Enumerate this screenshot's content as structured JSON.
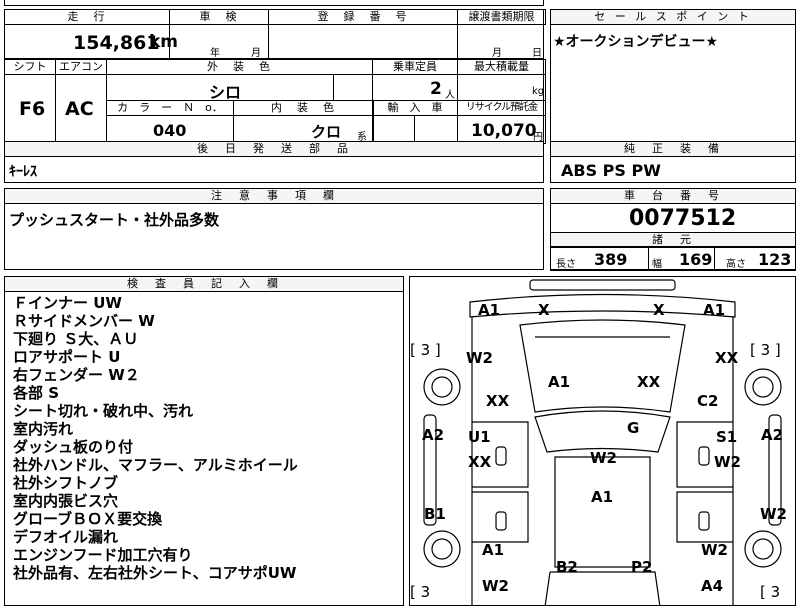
{
  "top": {
    "mileage_label": "走　行",
    "mileage_value": "154,861",
    "mileage_unit": "km",
    "inspection_label": "車　検",
    "year_unit": "年",
    "month_unit": "月",
    "reg_label": "登　録　番　号",
    "transfer_label": "譲渡書類期限",
    "t_month": "月",
    "t_day": "日"
  },
  "sales_point": {
    "label": "セ ー ル ス ポ イ ン ト",
    "text": "★オークションデビュー★"
  },
  "spec": {
    "shift_label": "シフト",
    "aircon_label": "エアコン",
    "exterior_label": "外　装　色",
    "capacity_label": "乗車定員",
    "maxload_label": "最大積載量",
    "shift_value": "F6",
    "aircon_value": "AC",
    "exterior_value": "シロ",
    "capacity_value": "2",
    "capacity_unit": "人",
    "maxload_unit": "kg",
    "color_no_label": "カ　ラ　ー　Ｎ　o．",
    "interior_label": "内　装　色",
    "import_label": "輸　入　車",
    "recycle_label": "リサイクル預託金",
    "color_no_value": "040",
    "interior_value": "クロ",
    "interior_unit": "系",
    "recycle_value": "10,070",
    "recycle_unit": "円"
  },
  "later_parts": {
    "label": "後　日　発　送　部　品",
    "text": "ｷｰﾚｽ"
  },
  "oem_equipment": {
    "label": "純　正　装　備",
    "text": "ABS PS PW"
  },
  "caution": {
    "label": "注　意　事　項　欄",
    "text": "プッシュスタート・社外品多数"
  },
  "chassis": {
    "label": "車　台　番　号",
    "value": "0077512"
  },
  "dimensions": {
    "label": "諸　元",
    "length_label": "長さ",
    "length": "389",
    "width_label": "幅",
    "width": "169",
    "height_label": "高さ",
    "height": "123"
  },
  "inspector": {
    "label": "検　査　員　記　入　欄",
    "lines": [
      "Ｆインナー UW",
      "Ｒサイドメンバー W",
      "下廻り Ｓ大、ＡＵ",
      "ロアサポート U",
      "右フェンダー W２",
      "各部 S",
      "シート切れ・破れ中、汚れ",
      "室内汚れ",
      "ダッシュ板のり付",
      "社外ハンドル、マフラー、アルミホイール",
      "社外シフトノブ",
      "室内内張ビス穴",
      "グローブＢＯＸ要交換",
      "デフオイル漏れ",
      "エンジンフード加工穴有り",
      "社外品有、左右社外シート、コアサポUW"
    ]
  },
  "diagram": {
    "tire_left": "[ 3 ]",
    "tire_right": "[ 3 ]",
    "tire_bl": "[ 3",
    "tire_br": "[ 3",
    "codes": {
      "a1_tl": "A1",
      "x_tl": "X",
      "x_tr": "X",
      "a1_tr": "A1",
      "w2_l": "W2",
      "xx_r": "XX",
      "a1_hood": "A1",
      "xx_hood": "XX",
      "xx_l": "XX",
      "c2": "C2",
      "g": "G",
      "a2_l": "A2",
      "u1": "U1",
      "s1": "S1",
      "a2_r": "A2",
      "xx_ld": "XX",
      "w2_roof": "W2",
      "w2_rd": "W2",
      "a1_roof": "A1",
      "b1": "B1",
      "w2_rs": "W2",
      "a1_bl": "A1",
      "w2_br": "W2",
      "w2_bl": "W2",
      "b2": "B2",
      "p2": "P2",
      "a4": "A4"
    }
  }
}
